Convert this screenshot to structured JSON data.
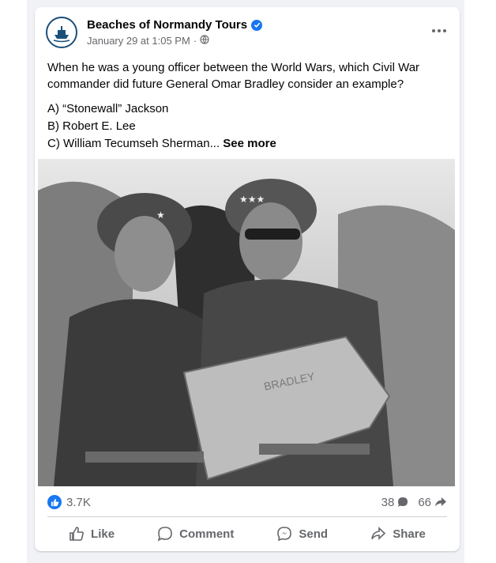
{
  "post": {
    "page_name": "Beaches of Normandy Tours",
    "timestamp": "January 29 at 1:05 PM",
    "separator": "·",
    "audience_icon": "globe-icon",
    "question": "When he was a young officer between the World Wars, which Civil War commander did future General Omar Bradley consider an example?",
    "options": [
      "A) “Stonewall” Jackson",
      "B) Robert E. Lee",
      "C) William Tecumseh Sherman..."
    ],
    "see_more": "See more",
    "photo_caption_text": "BRADLEY"
  },
  "stats": {
    "reactions": "3.7K",
    "comments": "38",
    "shares": "66"
  },
  "actions": {
    "like": "Like",
    "comment": "Comment",
    "send": "Send",
    "share": "Share"
  },
  "colors": {
    "brand_blue": "#1877f2",
    "secondary_text": "#65676b",
    "avatar_ring": "#1a4f7a"
  }
}
